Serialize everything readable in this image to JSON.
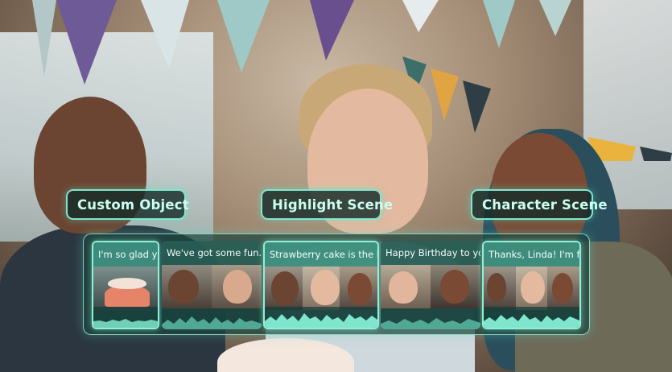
{
  "labels": {
    "custom_object": "Custom Object",
    "highlight_scene": "Highlight Scene",
    "character_scene": "Character Scene"
  },
  "timeline": {
    "clips": [
      {
        "caption": "I'm so glad you...",
        "selected": true
      },
      {
        "caption": "We've got some fun...",
        "selected": false
      },
      {
        "caption": "Strawberry cake is the best...",
        "selected": true
      },
      {
        "caption": "Happy Birthday to you...",
        "selected": false
      },
      {
        "caption": "Thanks, Linda! I'm feel...",
        "selected": true
      }
    ]
  },
  "colors": {
    "accent": "#7fe6cd",
    "label_text": "#c9fff0",
    "panel": "#1e4640"
  }
}
